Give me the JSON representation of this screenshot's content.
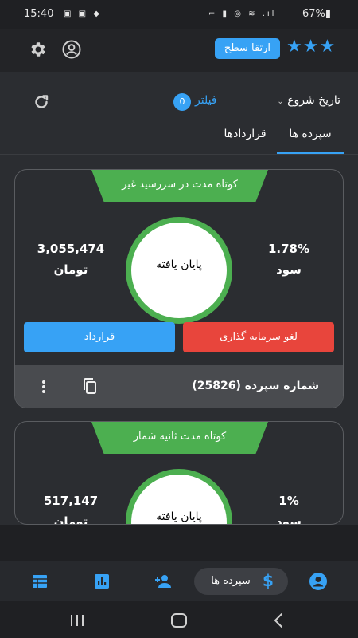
{
  "status_bar": {
    "time": "15:40",
    "left_icons": "▣ ▣ ◆",
    "right_icons": "⌐ ▮ ◎ ≋ .ıl",
    "battery": "67%▮"
  },
  "header": {
    "upgrade_label": "ارتقا سطح",
    "stars": "★★★",
    "icons": [
      "gear-icon",
      "account-circle-icon"
    ]
  },
  "filter_bar": {
    "sort_label": "تاریخ شروع",
    "filter_label": "فیلتر",
    "filter_count": "0",
    "icons": [
      "refresh-icon",
      "chevron-down-icon"
    ]
  },
  "tabs": [
    {
      "label": "سپرده ها",
      "active": true
    },
    {
      "label": "قراردادها",
      "active": false
    }
  ],
  "deposits": [
    {
      "type": "کوتاه مدت در سررسید غیر",
      "status": "پایان یافته",
      "amount": "3,055,474",
      "amount_unit": "تومان",
      "profit_pct": "1.78%",
      "profit_label": "سود",
      "cancel_label": "لغو سرمایه گذاری",
      "contract_label": "قرارداد",
      "number_label": "شماره سپرده (25826)"
    },
    {
      "type": "کوتاه مدت ثانیه شمار",
      "status": "پایان یافته",
      "amount": "517,147",
      "amount_unit": "تومان",
      "profit_pct": "1%",
      "profit_label": "سود"
    }
  ],
  "bottom_nav": {
    "active_label": "سپرده ها",
    "icons": [
      "account-circle-icon",
      "dollar-icon",
      "person-add-icon",
      "bar-chart-icon",
      "table-icon"
    ]
  },
  "colors": {
    "accent": "#37a2f5",
    "green": "#4caf50",
    "red": "#e8453c",
    "background": "#2b2d31"
  }
}
